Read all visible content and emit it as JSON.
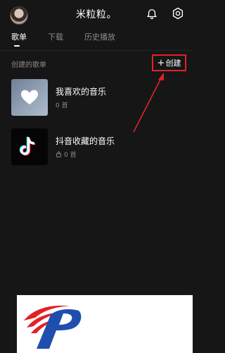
{
  "header": {
    "username": "米粒粒。",
    "icons": {
      "notifications": "bell-icon",
      "settings": "settings-icon"
    }
  },
  "tabs": [
    {
      "label": "歌单",
      "active": true
    },
    {
      "label": "下载",
      "active": false
    },
    {
      "label": "历史播放",
      "active": false
    }
  ],
  "section": {
    "title": "创建的歌单",
    "create_label": "创建",
    "create_icon": "plus-icon",
    "highlight_color": "#e3212b"
  },
  "playlists": [
    {
      "title": "我喜欢的音乐",
      "subtitle": "0 首",
      "icon": "heart-icon",
      "locked": false
    },
    {
      "title": "抖音收藏的音乐",
      "subtitle": "0 首",
      "icon": "tiktok-icon",
      "locked": true
    }
  ],
  "watermark": {
    "icon": "logo-icon"
  }
}
